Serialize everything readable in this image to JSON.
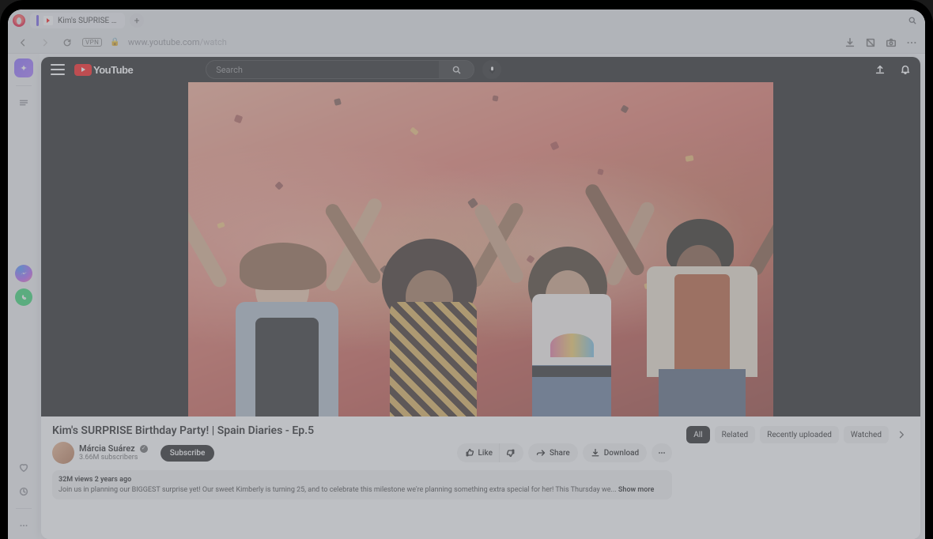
{
  "browser": {
    "tab_title": "Kim's SUPRISE Birt",
    "url_host": "www.youtube.com",
    "url_path": "/watch",
    "vpn_label": "VPN"
  },
  "youtube": {
    "logo_text": "YouTube",
    "search_placeholder": "Search"
  },
  "video": {
    "title": "Kim's SURPRISE Birthday Party! | Spain Diaries - Ep.5",
    "channel": "Márcia Suárez",
    "subscribers": "3.66M subscribers",
    "subscribe_label": "Subscribe",
    "like_label": "Like",
    "share_label": "Share",
    "download_label": "Download",
    "views_age": "32M views  2 years ago",
    "description": "Join us in planning our BIGGEST surprise yet! Our sweet Kimberly is turning 25, and to celebrate this milestone we're planning something extra special for her! This Thursday we...",
    "show_more": "Show more"
  },
  "chips": {
    "items": [
      "All",
      "Related",
      "Recently uploaded",
      "Watched"
    ],
    "active": 0
  }
}
